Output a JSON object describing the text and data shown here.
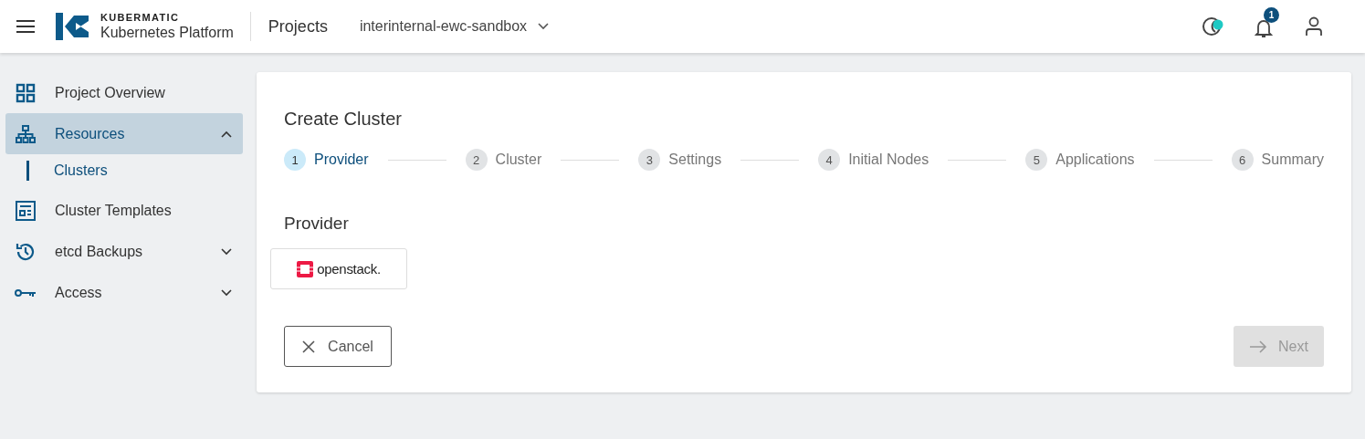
{
  "header": {
    "logo_top": "KUBERMATIC",
    "logo_bottom": "Kubernetes Platform",
    "section": "Projects",
    "project": "interinternal-ewc-sandbox",
    "notifications": "1"
  },
  "sidebar": {
    "items": [
      {
        "label": "Project Overview",
        "selected": false
      },
      {
        "label": "Resources",
        "selected": true,
        "expanded": true,
        "children": [
          {
            "label": "Clusters",
            "selected": true
          }
        ]
      },
      {
        "label": "Cluster Templates",
        "selected": false
      },
      {
        "label": "etcd Backups",
        "selected": false,
        "expanded": false
      },
      {
        "label": "Access",
        "selected": false,
        "expanded": false
      }
    ]
  },
  "card": {
    "title": "Create Cluster",
    "steps": [
      {
        "number": "1",
        "label": "Provider",
        "selected": true
      },
      {
        "number": "2",
        "label": "Cluster",
        "selected": false
      },
      {
        "number": "3",
        "label": "Settings",
        "selected": false
      },
      {
        "number": "4",
        "label": "Initial Nodes",
        "selected": false
      },
      {
        "number": "5",
        "label": "Applications",
        "selected": false
      },
      {
        "number": "6",
        "label": "Summary",
        "selected": false
      }
    ],
    "section": "Provider",
    "providers": [
      {
        "label": "openstack.",
        "selected": false
      }
    ],
    "cancel": "Cancel",
    "next": {
      "label": "Next",
      "disabled": true
    }
  }
}
